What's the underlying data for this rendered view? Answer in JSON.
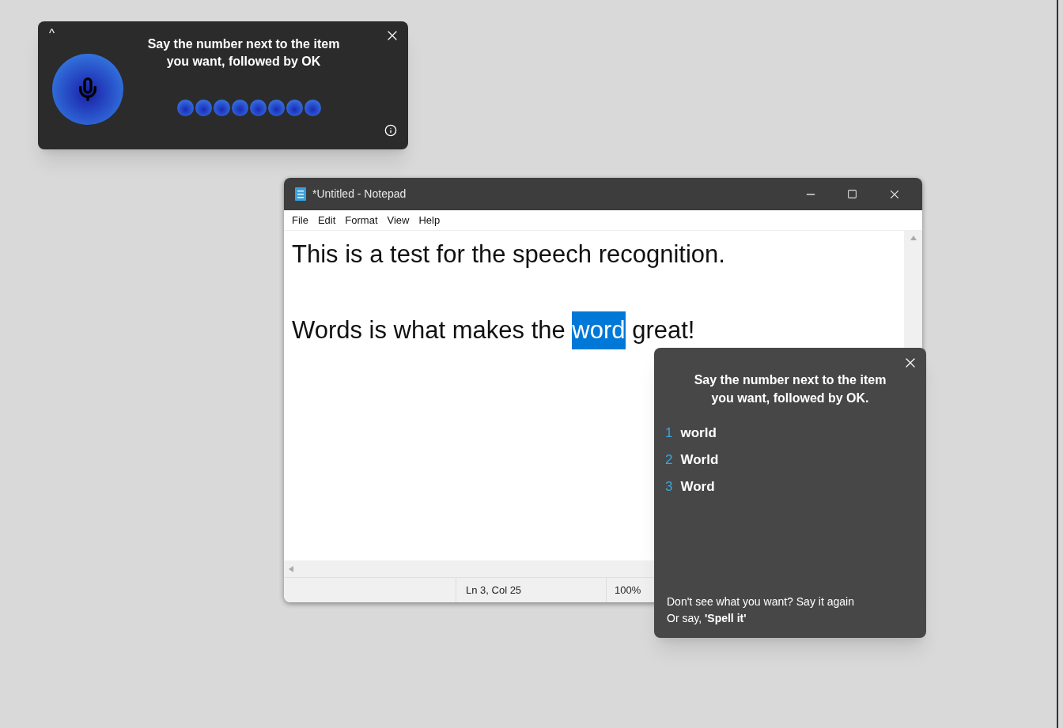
{
  "speech_bar": {
    "collapse_glyph": "^",
    "prompt": "Say the number next to the item you want, followed by OK"
  },
  "notepad": {
    "title": "*Untitled - Notepad",
    "menu": [
      "File",
      "Edit",
      "Format",
      "View",
      "Help"
    ],
    "lines": [
      {
        "blank_line_before": false,
        "segments": [
          {
            "text": "This is a test for the speech recognition.",
            "selected": false
          }
        ]
      },
      {
        "blank_line_before": true,
        "segments": [
          {
            "text": "Words is what makes the ",
            "selected": false
          },
          {
            "text": "word",
            "selected": true
          },
          {
            "text": " great!",
            "selected": false
          }
        ]
      }
    ],
    "status_bar": [
      "Ln 3, Col 25",
      "100%"
    ]
  },
  "correction_panel": {
    "prompt": "Say the number next to the item you want, followed by OK.",
    "items": [
      {
        "number": "1",
        "text": "world"
      },
      {
        "number": "2",
        "text": "World"
      },
      {
        "number": "3",
        "text": "Word"
      }
    ],
    "hint_lines": [
      "Don't see what you want? Say it again",
      "Or say, **'Spell it'**"
    ]
  }
}
